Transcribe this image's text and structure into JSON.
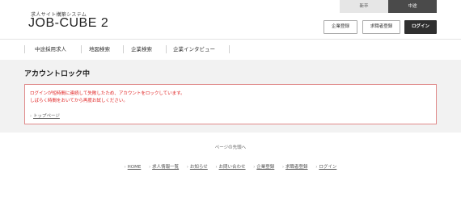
{
  "topbar": {
    "tab_shinsotsu": "新卒",
    "tab_chuto": "中途"
  },
  "brand": {
    "tagline": "求人サイト構築システム",
    "logo": "JOB-CUBE 2"
  },
  "header_buttons": {
    "company_register": "企業登録",
    "seeker_register": "求職者登録",
    "login": "ログイン"
  },
  "nav": {
    "items": [
      {
        "label": "中途採用求人"
      },
      {
        "label": "地図検索"
      },
      {
        "label": "企業検索"
      },
      {
        "label": "企業インタビュー"
      }
    ]
  },
  "main": {
    "title": "アカウントロック中",
    "message_line1": "ログインが短時間に連続して失敗したため、アカウントをロックしています。",
    "message_line2": "しばらく時間をおいてから再度お試しください。",
    "top_link": "トップページ"
  },
  "footer": {
    "to_top": "ページの先頭へ",
    "links": [
      {
        "label": "HOME"
      },
      {
        "label": "求人情報一覧"
      },
      {
        "label": "お知らせ"
      },
      {
        "label": "お問い合わせ"
      },
      {
        "label": "企業登録"
      },
      {
        "label": "求職者登録"
      },
      {
        "label": "ログイン"
      }
    ]
  },
  "icons": {
    "link_chevron": "chevron-right-icon"
  },
  "colors": {
    "error_text": "#e02020",
    "error_border": "#e08a8a",
    "dark_button": "#2f2f2f",
    "main_bg": "#f2f2f2"
  }
}
